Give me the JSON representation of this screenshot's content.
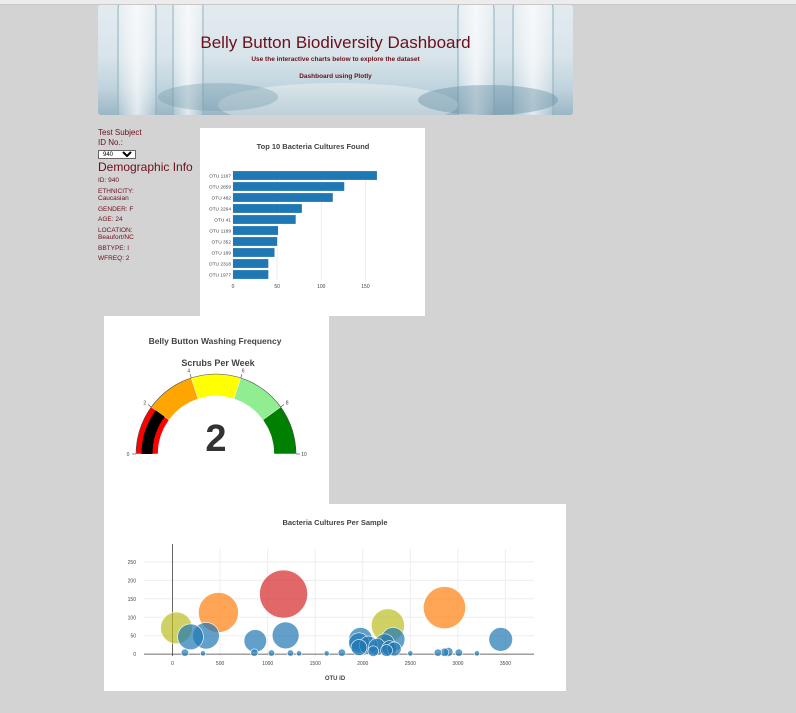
{
  "header": {
    "title": "Belly Button Biodiversity Dashboard",
    "subtitle": "Use the interactive charts below to explore the dataset",
    "subtitle2": "Dashboard using Plotly"
  },
  "sidebar": {
    "select_label": "Test Subject ID No.:",
    "selected_id": "940",
    "demo_title": "Demographic Info",
    "info": [
      "ID: 940",
      "ETHNICITY: Caucasian",
      "GENDER: F",
      "AGE: 24",
      "LOCATION: Beaufort/NC",
      "BBTYPE: I",
      "WFREQ: 2"
    ]
  },
  "colors": {
    "bar": "#1f77b4",
    "header_text": "#6b0f1a"
  },
  "chart_data": [
    {
      "type": "bar",
      "orientation": "horizontal",
      "title": "Top 10 Bacteria Cultures Found",
      "categories": [
        "OTU 1167",
        "OTU 2859",
        "OTU 482",
        "OTU 2264",
        "OTU 41",
        "OTU 1189",
        "OTU 352",
        "OTU 189",
        "OTU 2318",
        "OTU 1977"
      ],
      "values": [
        163,
        126,
        113,
        78,
        71,
        51,
        50,
        47,
        40,
        40
      ],
      "xticks": [
        0,
        50,
        100,
        150
      ],
      "xlim": [
        0,
        171
      ]
    },
    {
      "type": "gauge",
      "title": "Belly Button Washing Frequency",
      "subtitle": "Scrubs Per Week",
      "value": 2,
      "range": [
        0,
        10
      ],
      "ticks": [
        "0",
        "2",
        "4",
        "6",
        "8",
        "10"
      ],
      "steps": [
        {
          "range": [
            0,
            2
          ],
          "color": "#ff0000"
        },
        {
          "range": [
            2,
            4
          ],
          "color": "#ffa500"
        },
        {
          "range": [
            4,
            6
          ],
          "color": "#ffff00"
        },
        {
          "range": [
            6,
            8
          ],
          "color": "#90ee90"
        },
        {
          "range": [
            8,
            10
          ],
          "color": "#008000"
        }
      ],
      "bar_color": "#000000"
    },
    {
      "type": "scatter",
      "title": "Bacteria Cultures Per Sample",
      "xlabel": "OTU ID",
      "xticks": [
        0,
        500,
        1000,
        1500,
        2000,
        2500,
        3000,
        3500
      ],
      "yticks": [
        0,
        50,
        100,
        150,
        200,
        250
      ],
      "xlim": [
        -300,
        3800
      ],
      "ylim": [
        -5,
        285
      ],
      "points": [
        {
          "x": 1167,
          "y": 163,
          "color": "#d62728"
        },
        {
          "x": 2859,
          "y": 126,
          "color": "#ff7f0e"
        },
        {
          "x": 482,
          "y": 113,
          "color": "#ff7f0e"
        },
        {
          "x": 2264,
          "y": 78,
          "color": "#bcbd22"
        },
        {
          "x": 41,
          "y": 71,
          "color": "#bcbd22"
        },
        {
          "x": 1189,
          "y": 51,
          "color": "#1f77b4"
        },
        {
          "x": 352,
          "y": 50,
          "color": "#1f77b4"
        },
        {
          "x": 189,
          "y": 47,
          "color": "#1f77b4"
        },
        {
          "x": 3450,
          "y": 40,
          "color": "#1f77b4"
        },
        {
          "x": 1977,
          "y": 40,
          "color": "#1f77b4"
        },
        {
          "x": 2318,
          "y": 40,
          "color": "#1f77b4"
        },
        {
          "x": 870,
          "y": 36,
          "color": "#1f77b4"
        },
        {
          "x": 1960,
          "y": 30,
          "color": "#1f77b4"
        },
        {
          "x": 2230,
          "y": 28,
          "color": "#1f77b4"
        },
        {
          "x": 2060,
          "y": 24,
          "color": "#1f77b4"
        },
        {
          "x": 2150,
          "y": 20,
          "color": "#1f77b4"
        },
        {
          "x": 1960,
          "y": 18,
          "color": "#1f77b4"
        },
        {
          "x": 2280,
          "y": 16,
          "color": "#1f77b4"
        },
        {
          "x": 2330,
          "y": 14,
          "color": "#1f77b4"
        },
        {
          "x": 2250,
          "y": 10,
          "color": "#1f77b4"
        },
        {
          "x": 2110,
          "y": 8,
          "color": "#1f77b4"
        },
        {
          "x": 2900,
          "y": 6,
          "color": "#1f77b4"
        },
        {
          "x": 2860,
          "y": 5,
          "color": "#1f77b4"
        },
        {
          "x": 3010,
          "y": 4,
          "color": "#1f77b4"
        },
        {
          "x": 860,
          "y": 4,
          "color": "#1f77b4"
        },
        {
          "x": 1780,
          "y": 4,
          "color": "#1f77b4"
        },
        {
          "x": 2790,
          "y": 4,
          "color": "#1f77b4"
        },
        {
          "x": 130,
          "y": 4,
          "color": "#1f77b4"
        },
        {
          "x": 1240,
          "y": 3,
          "color": "#1f77b4"
        },
        {
          "x": 1040,
          "y": 3,
          "color": "#1f77b4"
        },
        {
          "x": 1330,
          "y": 2,
          "color": "#1f77b4"
        },
        {
          "x": 320,
          "y": 2,
          "color": "#1f77b4"
        },
        {
          "x": 2500,
          "y": 2,
          "color": "#1f77b4"
        },
        {
          "x": 3200,
          "y": 2,
          "color": "#1f77b4"
        },
        {
          "x": 1620,
          "y": 2,
          "color": "#1f77b4"
        }
      ]
    }
  ]
}
